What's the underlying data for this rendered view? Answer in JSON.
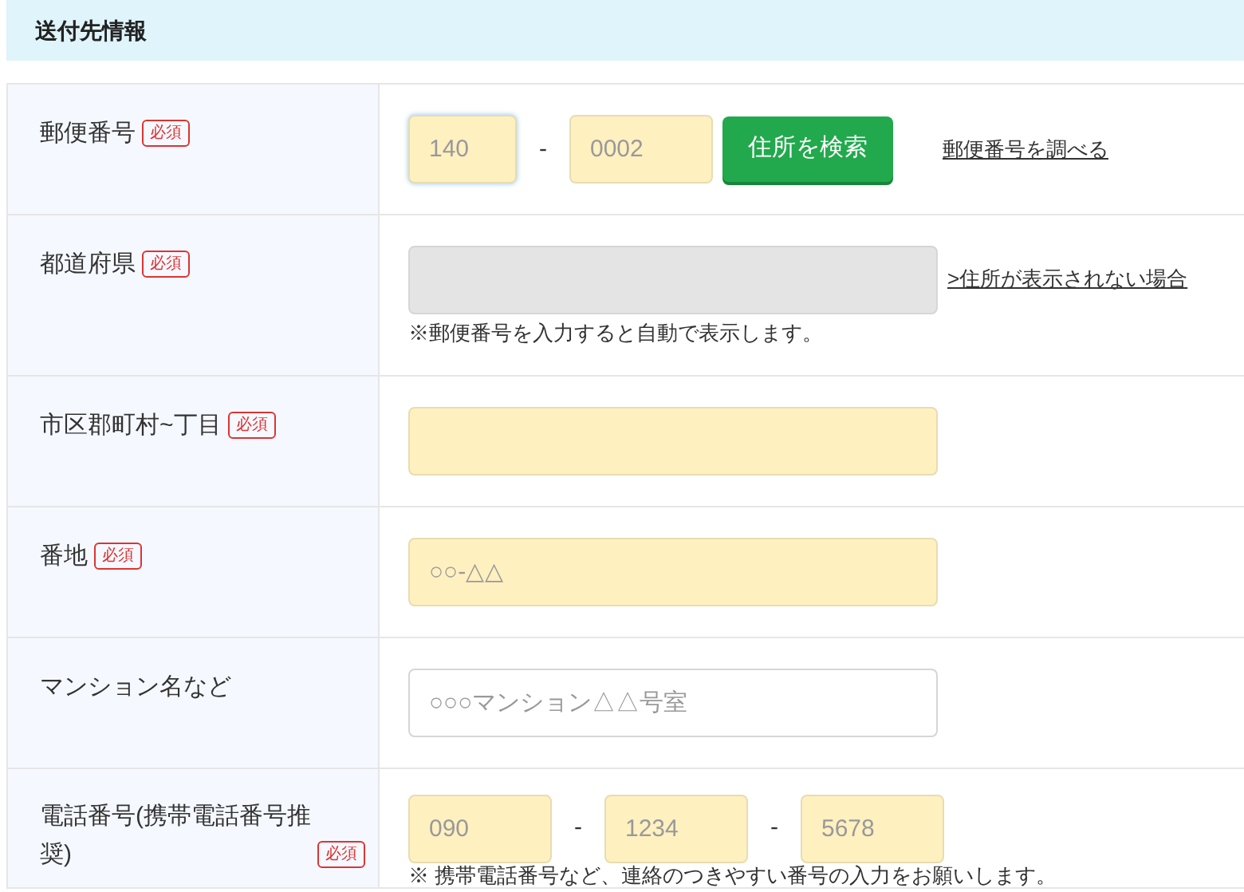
{
  "section_title": "送付先情報",
  "rows": [
    {
      "kind": "postal",
      "label": "郵便番号",
      "required": true,
      "badge": "必須",
      "fields": [
        {
          "placeholder": "140",
          "focused": true
        },
        {
          "placeholder": "0002",
          "focused": false
        }
      ],
      "separator": "-",
      "button": "住所を検索",
      "link": "郵便番号を調べる"
    },
    {
      "kind": "prefecture",
      "label": "都道府県",
      "required": true,
      "badge": "必須",
      "disabled": true,
      "link": ">住所が表示されない場合",
      "note": "※郵便番号を入力すると自動で表示します。"
    },
    {
      "kind": "text",
      "label": "市区郡町村~丁目",
      "required": true,
      "badge": "必須"
    },
    {
      "kind": "text",
      "label": "番地",
      "required": true,
      "badge": "必須",
      "placeholder": "○○-△△"
    },
    {
      "kind": "text",
      "label": "マンション名など",
      "required": false,
      "placeholder": "○○○マンション△△号室"
    },
    {
      "kind": "phone",
      "label": "電話番号(携帯電話番号推奨)",
      "required": true,
      "badge": "必須",
      "fields": [
        {
          "placeholder": "090"
        },
        {
          "placeholder": "1234"
        },
        {
          "placeholder": "5678"
        }
      ],
      "separators": [
        "-",
        "-"
      ],
      "note": "※ 携帯電話番号など、連絡のつきやすい番号の入力をお願いします。"
    }
  ]
}
